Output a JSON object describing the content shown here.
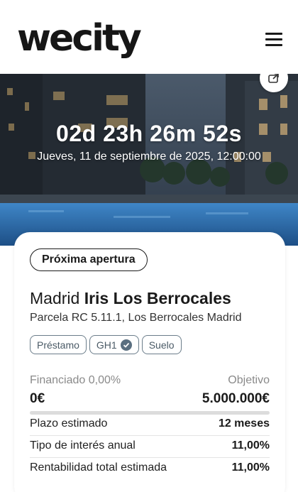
{
  "header": {
    "logo": "wecity",
    "menu_icon": "hamburger-menu-icon"
  },
  "hero": {
    "countdown": "02d 23h 26m 52s",
    "datetime": "Jueves, 11 de septiembre de 2025, 12:00:00",
    "share_icon": "share-icon"
  },
  "project": {
    "status_badge": "Próxima apertura",
    "city": "Madrid",
    "name": "Iris Los Berrocales",
    "subtitle": "Parcela RC 5.11.1, Los Berrocales Madrid",
    "tags": [
      {
        "label": "Préstamo",
        "verified": false
      },
      {
        "label": "GH1",
        "verified": true
      },
      {
        "label": "Suelo",
        "verified": false
      }
    ],
    "financed_label": "Financiado 0,00%",
    "financed_value": "0€",
    "financed_fraction": 0.0,
    "objective_label": "Objetivo",
    "objective_value": "5.000.000€",
    "stats": [
      {
        "label": "Plazo estimado",
        "value": "12 meses"
      },
      {
        "label": "Tipo de interés anual",
        "value": "11,00%"
      },
      {
        "label": "Rentabilidad total estimada",
        "value": "11,00%"
      }
    ]
  },
  "colors": {
    "text_primary": "#1a1a1a",
    "tag_border": "#6b7d8a",
    "progress_track": "#dcdcdc",
    "progress_fill": "#1a1a1a"
  }
}
